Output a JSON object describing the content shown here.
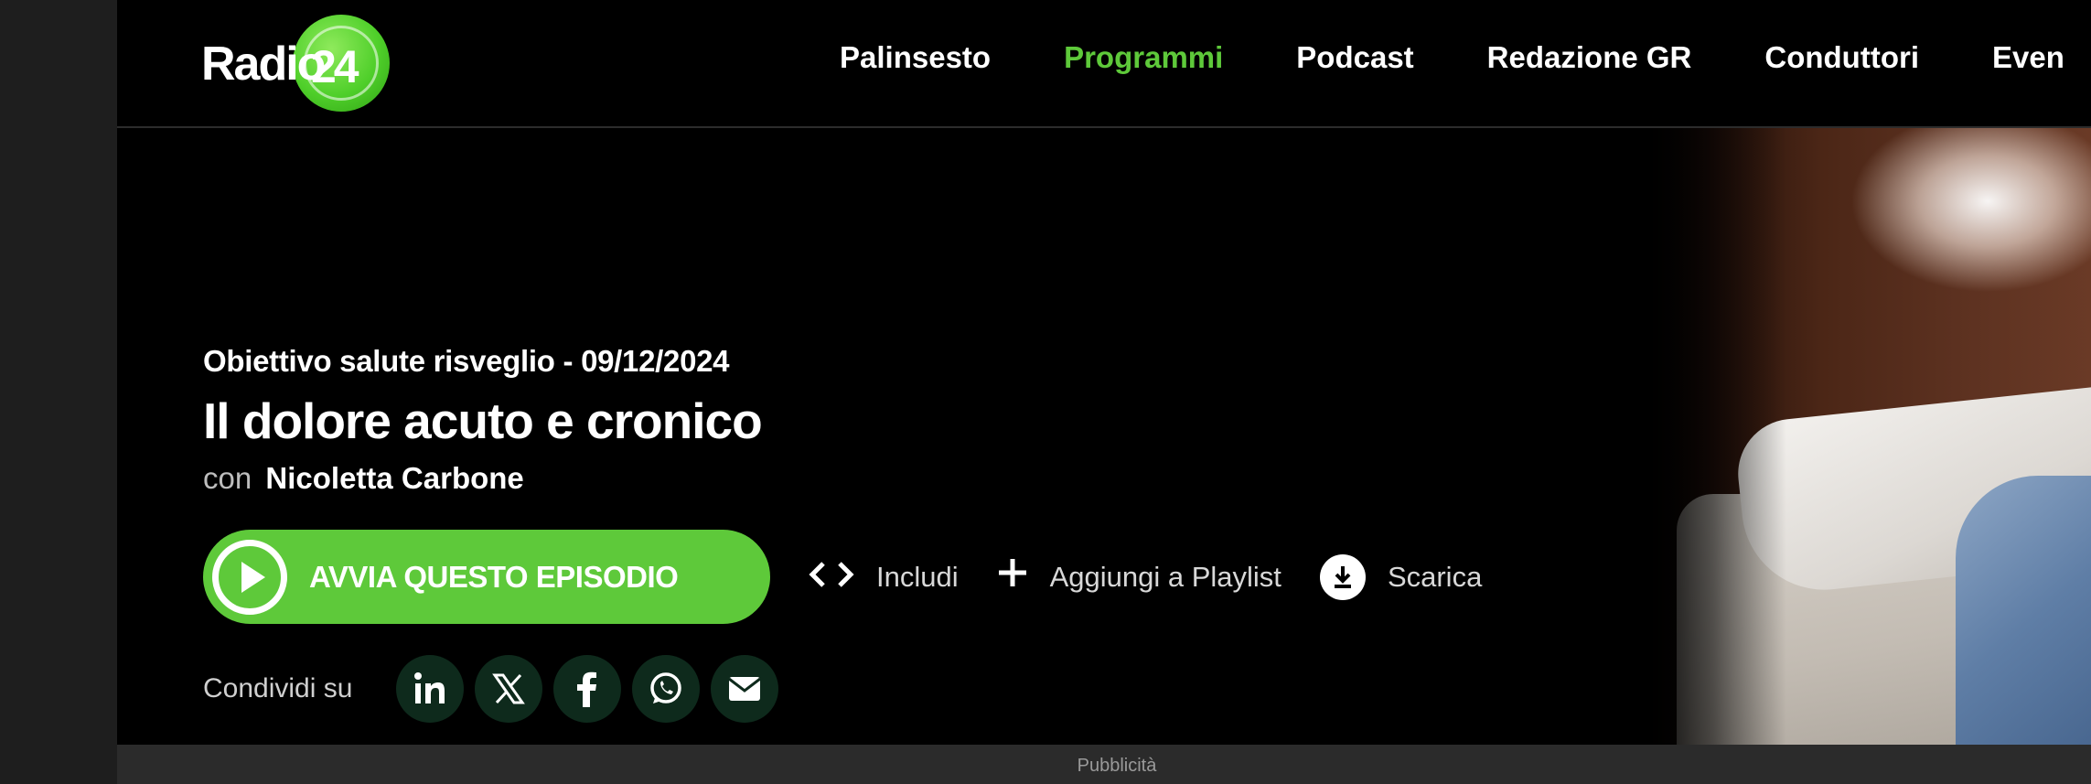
{
  "header": {
    "logo_text": "Radio",
    "logo_number": "24",
    "nav": [
      {
        "label": "Palinsesto",
        "active": false
      },
      {
        "label": "Programmi",
        "active": true
      },
      {
        "label": "Podcast",
        "active": false
      },
      {
        "label": "Redazione GR",
        "active": false
      },
      {
        "label": "Conduttori",
        "active": false
      },
      {
        "label": "Even",
        "active": false
      }
    ]
  },
  "episode": {
    "program_and_date": "Obiettivo salute risveglio - 09/12/2024",
    "title": "Il dolore acuto e cronico",
    "host_prefix": "con",
    "host_name": "Nicoletta Carbone"
  },
  "actions": {
    "play_label": "AVVIA QUESTO EPISODIO",
    "embed_label": "Includi",
    "playlist_label": "Aggiungi a Playlist",
    "download_label": "Scarica"
  },
  "share": {
    "label": "Condividi su",
    "networks": [
      "linkedin-icon",
      "x-icon",
      "facebook-icon",
      "whatsapp-icon",
      "email-icon"
    ]
  },
  "ad": {
    "label": "Pubblicità"
  },
  "colors": {
    "accent": "#5ec93a",
    "background": "#000000",
    "social_bg": "#0e2a1c"
  }
}
